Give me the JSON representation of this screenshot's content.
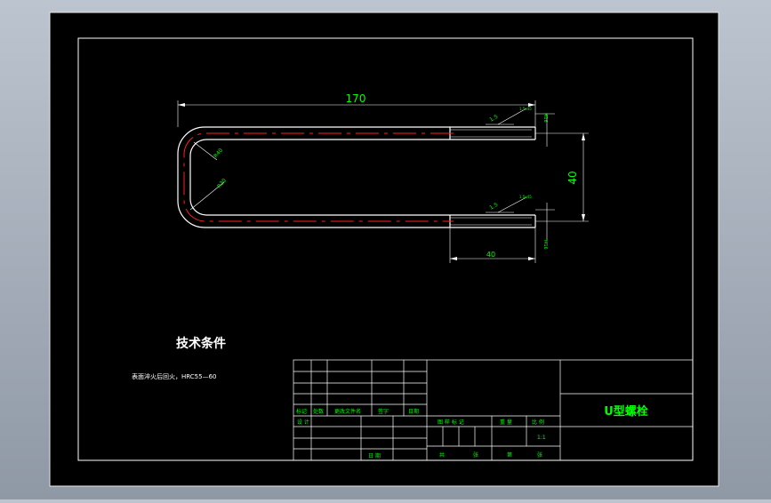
{
  "colors": {
    "background_outer": "#9aa3ae",
    "sheet": "#000000",
    "frame": "#ffffff",
    "dimension": "#00ff00",
    "centerline": "#ff0000",
    "title_text": "#00ff00"
  },
  "drawing": {
    "dim_overall_length": "170",
    "dim_spacing": "40",
    "dim_thread_length": "40",
    "radius_outer": "R40",
    "radius_inner": "R30",
    "chamfer_top": "1.5",
    "chamfer_bottom": "1.5",
    "thread_top": "M16",
    "thread_bottom": "M16",
    "note_top": "1.5x45",
    "note_bottom": "1.5x45"
  },
  "tech": {
    "heading": "技术条件",
    "line1": "表面淬火后回火，HRC55—60"
  },
  "title_block": {
    "part_name": "U型螺栓",
    "rev_headers": [
      "标记",
      "处数",
      "更改文件名",
      "签字",
      "日期"
    ],
    "design_label": "设 计",
    "date_label": "日 期",
    "stage_label": "图 样 标 记",
    "weight_label": "重 量",
    "scale_label": "比 例",
    "scale_value": "1:1",
    "sheets_total_label": "共",
    "sheet_unit_label": "张",
    "sheet_no_label": "第",
    "sheet_unit_label2": "张"
  }
}
